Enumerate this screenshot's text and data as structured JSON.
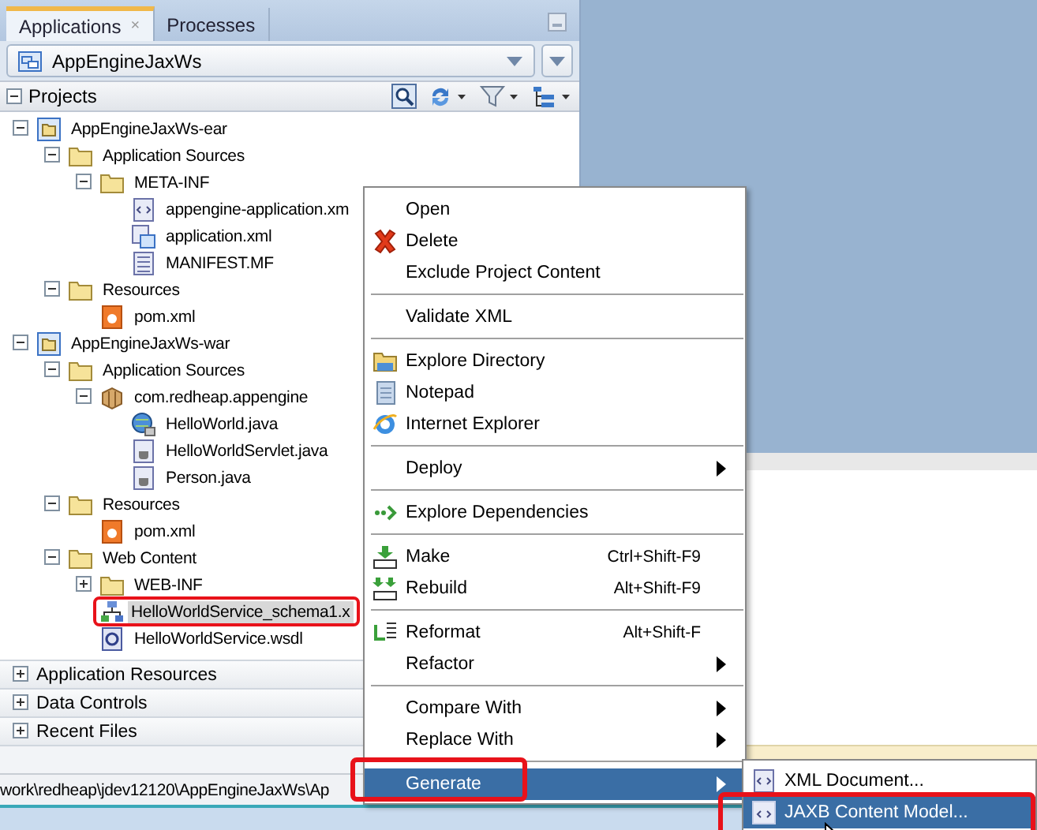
{
  "panel": {
    "tabs": [
      {
        "label": "Applications",
        "selected": true,
        "close": "×"
      },
      {
        "label": "Processes",
        "selected": false
      }
    ],
    "application": "AppEngineJaxWs",
    "section": {
      "title": "Projects",
      "expanded": true
    },
    "tree": [
      {
        "label": "AppEngineJaxWs-ear",
        "kind": "project",
        "expanded": true,
        "selected": false,
        "children": [
          {
            "label": "Application Sources",
            "kind": "folder",
            "expanded": true,
            "selected": false,
            "children": [
              {
                "label": "META-INF",
                "kind": "folder",
                "expanded": true,
                "selected": false,
                "children": [
                  {
                    "label": "appengine-application.xm",
                    "kind": "xml",
                    "selected": false
                  },
                  {
                    "label": "application.xml",
                    "kind": "descriptor",
                    "selected": false
                  },
                  {
                    "label": "MANIFEST.MF",
                    "kind": "manifest",
                    "selected": false
                  }
                ]
              }
            ]
          },
          {
            "label": "Resources",
            "kind": "folder",
            "expanded": true,
            "selected": false,
            "children": [
              {
                "label": "pom.xml",
                "kind": "maven",
                "selected": false
              }
            ]
          }
        ]
      },
      {
        "label": "AppEngineJaxWs-war",
        "kind": "project",
        "expanded": true,
        "selected": false,
        "children": [
          {
            "label": "Application Sources",
            "kind": "folder",
            "expanded": true,
            "selected": false,
            "children": [
              {
                "label": "com.redheap.appengine",
                "kind": "package",
                "expanded": true,
                "selected": false,
                "children": [
                  {
                    "label": "HelloWorld.java",
                    "kind": "service",
                    "selected": false
                  },
                  {
                    "label": "HelloWorldServlet.java",
                    "kind": "java",
                    "selected": false
                  },
                  {
                    "label": "Person.java",
                    "kind": "java",
                    "selected": false
                  }
                ]
              }
            ]
          },
          {
            "label": "Resources",
            "kind": "folder",
            "expanded": true,
            "selected": false,
            "children": [
              {
                "label": "pom.xml",
                "kind": "maven",
                "selected": false
              }
            ]
          },
          {
            "label": "Web Content",
            "kind": "folder",
            "expanded": true,
            "selected": false,
            "children": [
              {
                "label": "WEB-INF",
                "kind": "folder",
                "expanded": false,
                "selected": false
              },
              {
                "label": "HelloWorldService_schema1.x",
                "kind": "schema",
                "selected": true,
                "highlighted": true
              },
              {
                "label": "HelloWorldService.wsdl",
                "kind": "wsdl",
                "selected": false
              }
            ]
          }
        ]
      }
    ],
    "accordions": [
      {
        "label": "Application Resources",
        "expanded": false
      },
      {
        "label": "Data Controls",
        "expanded": false
      },
      {
        "label": "Recent Files",
        "expanded": false
      }
    ]
  },
  "status_bar": {
    "path": "work\\redheap\\jdev12120\\AppEngineJaxWs\\Ap"
  },
  "context_menu": {
    "items": [
      {
        "kind": "item",
        "label": "Open",
        "selected": false
      },
      {
        "kind": "delete",
        "label": "Delete",
        "selected": false
      },
      {
        "kind": "item",
        "label": "Exclude Project Content",
        "selected": false
      },
      {
        "kind": "separator"
      },
      {
        "kind": "item",
        "label": "Validate XML",
        "selected": false
      },
      {
        "kind": "separator"
      },
      {
        "kind": "explore",
        "label": "Explore Directory",
        "selected": false
      },
      {
        "kind": "notepad",
        "label": "Notepad",
        "selected": false
      },
      {
        "kind": "browser",
        "label": "Internet Explorer",
        "selected": false
      },
      {
        "kind": "separator"
      },
      {
        "kind": "item",
        "label": "Deploy",
        "submenu": true,
        "selected": false
      },
      {
        "kind": "separator"
      },
      {
        "kind": "deps",
        "label": "Explore Dependencies",
        "selected": false
      },
      {
        "kind": "separator"
      },
      {
        "kind": "make",
        "label": "Make",
        "shortcut": "Ctrl+Shift-F9",
        "selected": false
      },
      {
        "kind": "rebuild",
        "label": "Rebuild",
        "shortcut": "Alt+Shift-F9",
        "selected": false
      },
      {
        "kind": "separator"
      },
      {
        "kind": "reformat",
        "label": "Reformat",
        "shortcut": "Alt+Shift-F",
        "selected": false
      },
      {
        "kind": "item",
        "label": "Refactor",
        "submenu": true,
        "selected": false
      },
      {
        "kind": "separator"
      },
      {
        "kind": "item",
        "label": "Compare With",
        "submenu": true,
        "selected": false
      },
      {
        "kind": "item",
        "label": "Replace With",
        "submenu": true,
        "selected": false
      },
      {
        "kind": "separator"
      },
      {
        "kind": "item",
        "label": "Generate",
        "submenu": true,
        "selected": true,
        "highlighted": true
      }
    ]
  },
  "submenu": {
    "items": [
      {
        "label": "XML Document...",
        "kind": "xmldoc",
        "selected": false
      },
      {
        "label": "JAXB Content Model...",
        "kind": "jaxb",
        "selected": true,
        "highlighted": true
      }
    ]
  }
}
